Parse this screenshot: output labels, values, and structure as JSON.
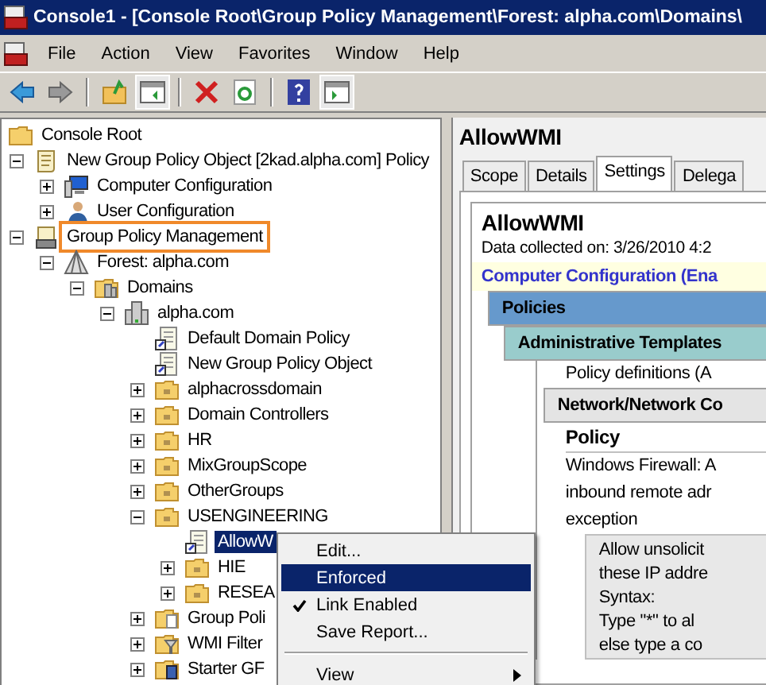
{
  "window": {
    "title": "Console1 - [Console Root\\Group Policy Management\\Forest: alpha.com\\Domains\\"
  },
  "menu_bar": [
    "File",
    "Action",
    "View",
    "Favorites",
    "Window",
    "Help"
  ],
  "toolbar": [
    {
      "kind": "back",
      "pressed": false
    },
    {
      "kind": "forward",
      "pressed": false
    },
    {
      "kind": "up",
      "pressed": false
    },
    {
      "kind": "tree",
      "pressed": true
    },
    {
      "kind": "delete",
      "pressed": false
    },
    {
      "kind": "refresh",
      "pressed": false
    },
    {
      "kind": "help",
      "pressed": false
    },
    {
      "kind": "actionpane",
      "pressed": true
    }
  ],
  "tree": {
    "items": [
      {
        "label": "Console Root",
        "kind": "folder",
        "selected": false,
        "children": [
          {
            "label": "New Group Policy Object [2kad.alpha.com] Policy",
            "kind": "scroll",
            "expanded": true,
            "selected": false,
            "children": [
              {
                "label": "Computer Configuration",
                "kind": "computer",
                "expanded": false,
                "selected": false
              },
              {
                "label": "User Configuration",
                "kind": "user",
                "expanded": false,
                "selected": false
              }
            ]
          },
          {
            "label": "Group Policy Management",
            "kind": "gpm",
            "expanded": true,
            "selected": false,
            "highlighted": true,
            "children": [
              {
                "label": "Forest: alpha.com",
                "kind": "forest",
                "expanded": true,
                "selected": false,
                "children": [
                  {
                    "label": "Domains",
                    "kind": "domains",
                    "expanded": true,
                    "selected": false,
                    "children": [
                      {
                        "label": "alpha.com",
                        "kind": "domain",
                        "expanded": true,
                        "selected": false,
                        "children": [
                          {
                            "label": "Default Domain Policy",
                            "kind": "link",
                            "selected": false
                          },
                          {
                            "label": "New Group Policy Object",
                            "kind": "link",
                            "selected": false
                          },
                          {
                            "label": "alphacrossdomain",
                            "kind": "ou",
                            "expanded": false,
                            "selected": false
                          },
                          {
                            "label": "Domain Controllers",
                            "kind": "ou",
                            "expanded": false,
                            "selected": false
                          },
                          {
                            "label": "HR",
                            "kind": "ou",
                            "expanded": false,
                            "selected": false
                          },
                          {
                            "label": "MixGroupScope",
                            "kind": "ou",
                            "expanded": false,
                            "selected": false
                          },
                          {
                            "label": "OtherGroups",
                            "kind": "ou",
                            "expanded": false,
                            "selected": false
                          },
                          {
                            "label": "USENGINEERING",
                            "kind": "ou",
                            "expanded": true,
                            "selected": false,
                            "children": [
                              {
                                "label": "AllowW",
                                "kind": "link",
                                "selected": true
                              },
                              {
                                "label": "HIE",
                                "kind": "ou",
                                "expanded": false,
                                "selected": false
                              },
                              {
                                "label": "RESEA",
                                "kind": "ou",
                                "expanded": false,
                                "selected": false
                              }
                            ]
                          },
                          {
                            "label": "Group Poli",
                            "kind": "gpofolder",
                            "expanded": false,
                            "selected": false
                          },
                          {
                            "label": "WMI Filter",
                            "kind": "wmi",
                            "expanded": false,
                            "selected": false
                          },
                          {
                            "label": "Starter GF",
                            "kind": "starter",
                            "expanded": false,
                            "selected": false
                          }
                        ]
                      }
                    ]
                  }
                ]
              }
            ]
          }
        ]
      }
    ]
  },
  "context_menu": {
    "items": [
      {
        "kind": "item",
        "label": "Edit...",
        "selected": false,
        "checked": false
      },
      {
        "kind": "item",
        "label": "Enforced",
        "selected": true,
        "checked": false
      },
      {
        "kind": "item",
        "label": "Link Enabled",
        "selected": false,
        "checked": true
      },
      {
        "kind": "item",
        "label": "Save Report...",
        "selected": false,
        "checked": false
      },
      {
        "kind": "separator"
      },
      {
        "kind": "submenu",
        "label": "View",
        "selected": false,
        "checked": false
      }
    ]
  },
  "details": {
    "title": "AllowWMI",
    "tabs": [
      {
        "label": "Scope",
        "selected": false
      },
      {
        "label": "Details",
        "selected": false
      },
      {
        "label": "Settings",
        "selected": true
      },
      {
        "label": "Delega",
        "selected": false
      }
    ],
    "report": {
      "title": "AllowWMI",
      "collected": "Data collected on: 3/26/2010 4:2",
      "rows": [
        {
          "kind": "config",
          "text": "Computer Configuration (Ena"
        },
        {
          "kind": "policies",
          "text": "Policies"
        },
        {
          "kind": "templates",
          "text": "Administrative Templates"
        },
        {
          "kind": "line",
          "text": "Policy definitions (A"
        },
        {
          "kind": "category",
          "text": "Network/Network Co"
        },
        {
          "kind": "heading",
          "text": "Policy"
        },
        {
          "kind": "line",
          "text": "Windows Firewall: A"
        },
        {
          "kind": "line",
          "text": "inbound remote adr"
        },
        {
          "kind": "line",
          "text": "exception"
        }
      ],
      "note": [
        "Allow unsolicit",
        "these IP addre",
        "Syntax:",
        "Type \"*\" to al",
        "else type a co"
      ]
    }
  }
}
